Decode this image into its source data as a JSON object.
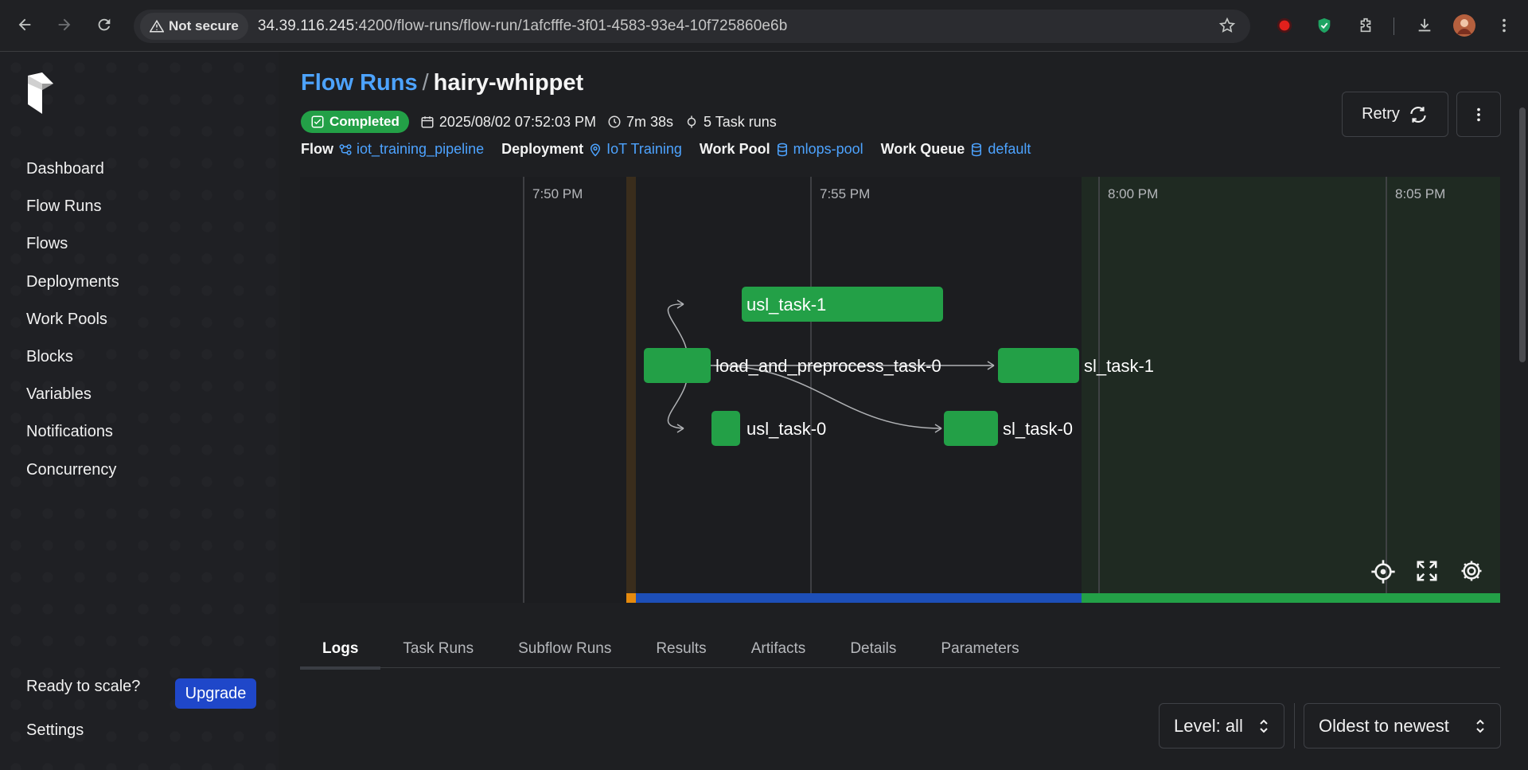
{
  "browser": {
    "security_label": "Not secure",
    "url_host": "34.39.116.245",
    "url_path": ":4200/flow-runs/flow-run/1afcfffe-3f01-4583-93e4-10f725860e6b"
  },
  "sidebar": {
    "items": [
      {
        "label": "Dashboard"
      },
      {
        "label": "Flow Runs"
      },
      {
        "label": "Flows"
      },
      {
        "label": "Deployments"
      },
      {
        "label": "Work Pools"
      },
      {
        "label": "Blocks"
      },
      {
        "label": "Variables"
      },
      {
        "label": "Notifications"
      },
      {
        "label": "Concurrency"
      }
    ],
    "scale_text": "Ready to scale?",
    "upgrade_label": "Upgrade",
    "settings_label": "Settings"
  },
  "header": {
    "breadcrumb": "Flow Runs",
    "separator": "/",
    "run_name": "hairy-whippet",
    "status": "Completed",
    "start_time": "2025/08/02 07:52:03 PM",
    "duration": "7m 38s",
    "task_runs": "5 Task runs",
    "retry_label": "Retry"
  },
  "info": {
    "flow_label": "Flow",
    "flow_value": "iot_training_pipeline",
    "deployment_label": "Deployment",
    "deployment_value": "IoT Training",
    "work_pool_label": "Work Pool",
    "work_pool_value": "mlops-pool",
    "work_queue_label": "Work Queue",
    "work_queue_value": "default"
  },
  "graph": {
    "time_ticks": [
      "7:50 PM",
      "7:55 PM",
      "8:00 PM",
      "8:05 PM"
    ],
    "nodes": [
      {
        "label": "usl_task-1"
      },
      {
        "label": "load_and_preprocess_task-0"
      },
      {
        "label": "sl_task-1"
      },
      {
        "label": "usl_task-0"
      },
      {
        "label": "sl_task-0"
      }
    ],
    "colors": {
      "completed": "#23a047",
      "running": "#1d4fb8",
      "pending": "#e58a0e"
    }
  },
  "tabs": [
    {
      "label": "Logs"
    },
    {
      "label": "Task Runs"
    },
    {
      "label": "Subflow Runs"
    },
    {
      "label": "Results"
    },
    {
      "label": "Artifacts"
    },
    {
      "label": "Details"
    },
    {
      "label": "Parameters"
    }
  ],
  "filters": {
    "level": "Level: all",
    "order": "Oldest to newest"
  }
}
